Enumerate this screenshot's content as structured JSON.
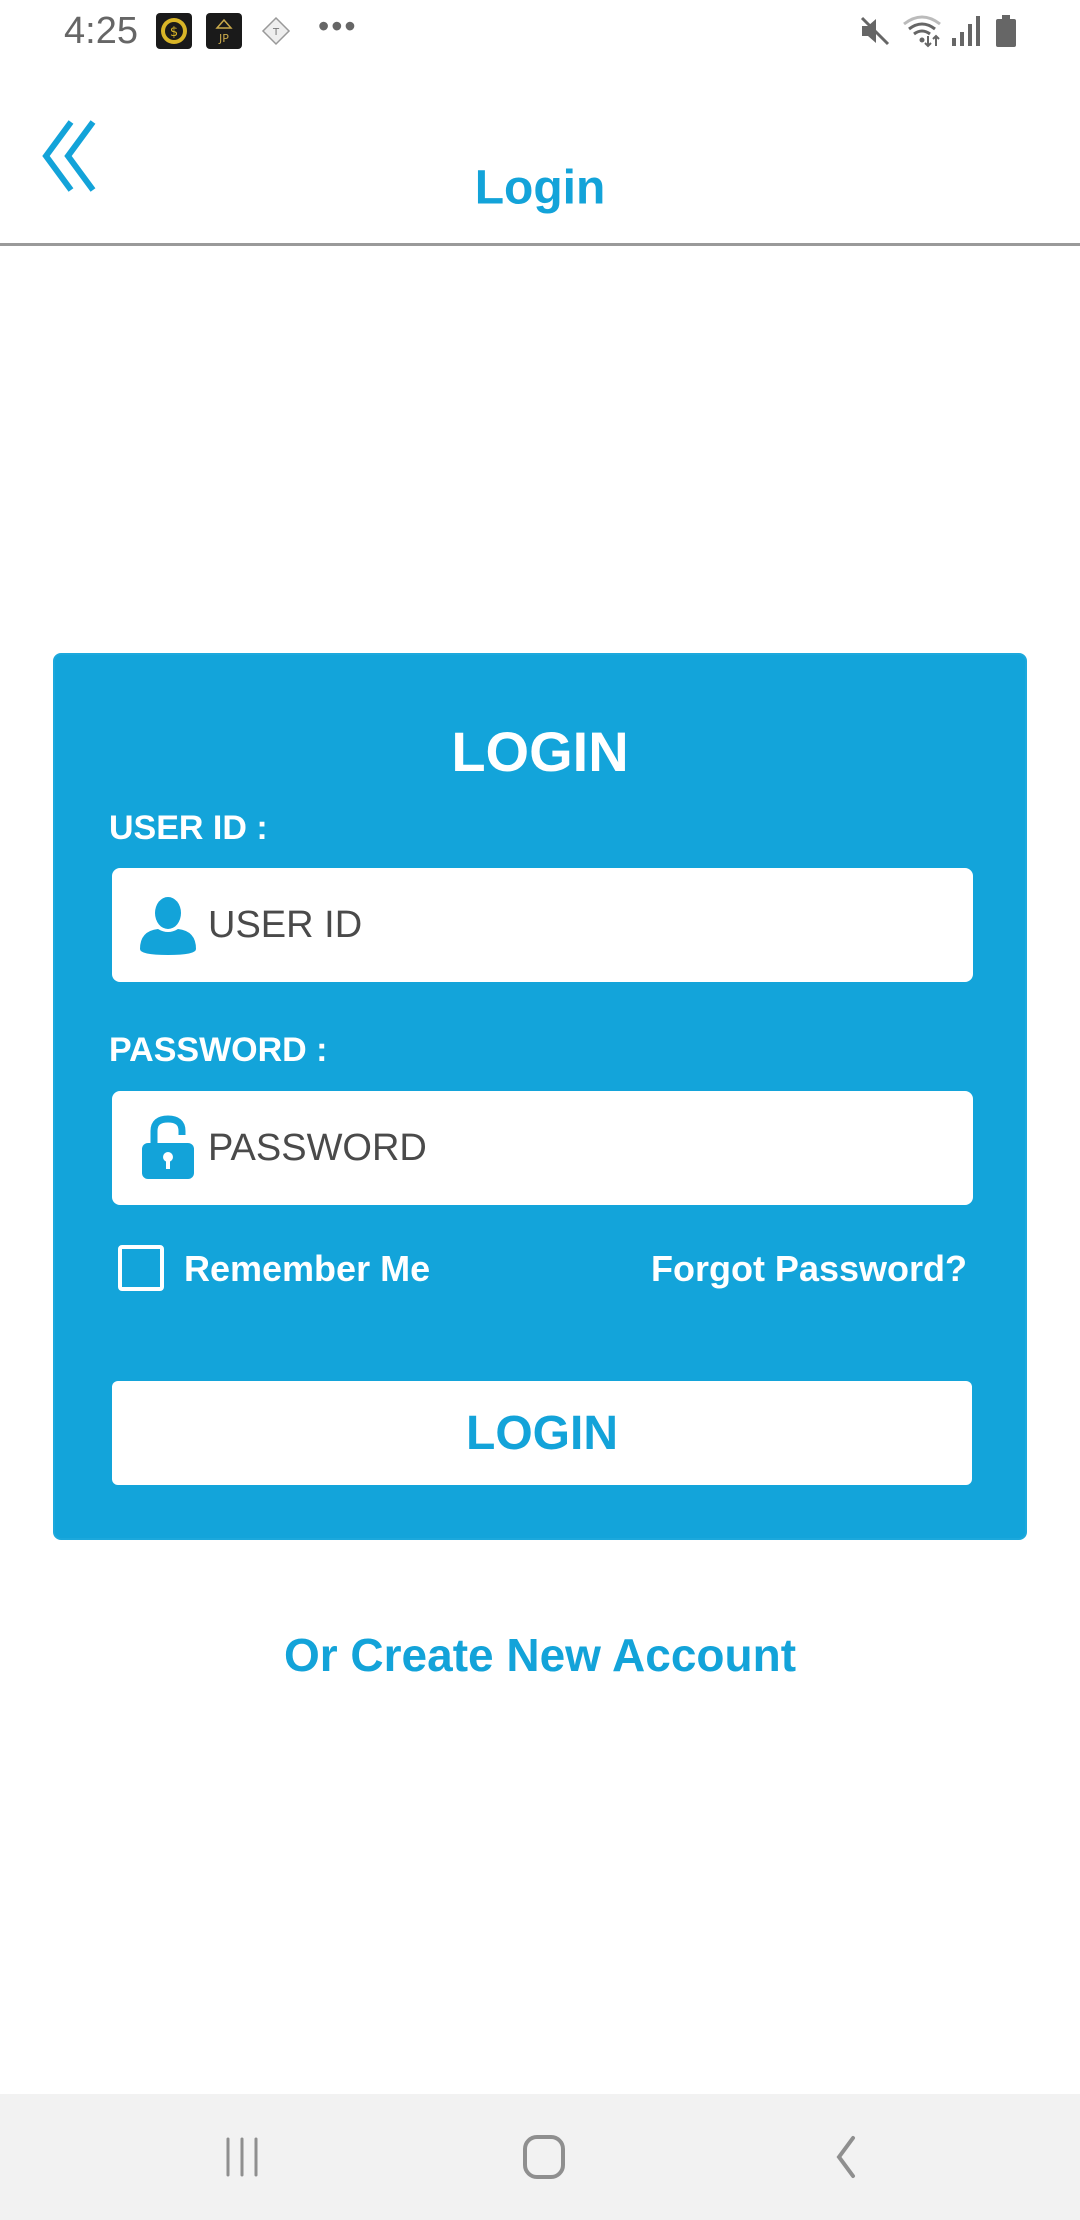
{
  "status_bar": {
    "time": "4:25",
    "notification_icons": [
      "app-notification-icon-gold-seal",
      "app-notification-icon-jp",
      "app-notification-icon-diamond"
    ],
    "more_indicator": "•••",
    "system_icons": [
      "mute-icon",
      "wifi-icon",
      "signal-icon",
      "battery-icon"
    ]
  },
  "app_bar": {
    "back_icon": "double-chevron-left-icon",
    "title": "Login"
  },
  "login_card": {
    "title": "LOGIN",
    "user_id": {
      "label": "USER ID :",
      "placeholder": "USER ID",
      "value": "",
      "icon": "user-icon"
    },
    "password": {
      "label": "PASSWORD :",
      "placeholder": "PASSWORD",
      "value": "",
      "icon": "unlock-icon"
    },
    "remember_me": {
      "label": "Remember Me",
      "checked": false
    },
    "forgot_password": "Forgot Password?",
    "login_button": "LOGIN"
  },
  "create_account_link": "Or Create New Account",
  "colors": {
    "accent": "#13a3d9",
    "card_background": "#13a4da",
    "divider": "#9a9a9a",
    "nav_bar_background": "#f2f2f2"
  },
  "nav_bar": {
    "buttons": [
      "recents",
      "home",
      "back"
    ]
  }
}
